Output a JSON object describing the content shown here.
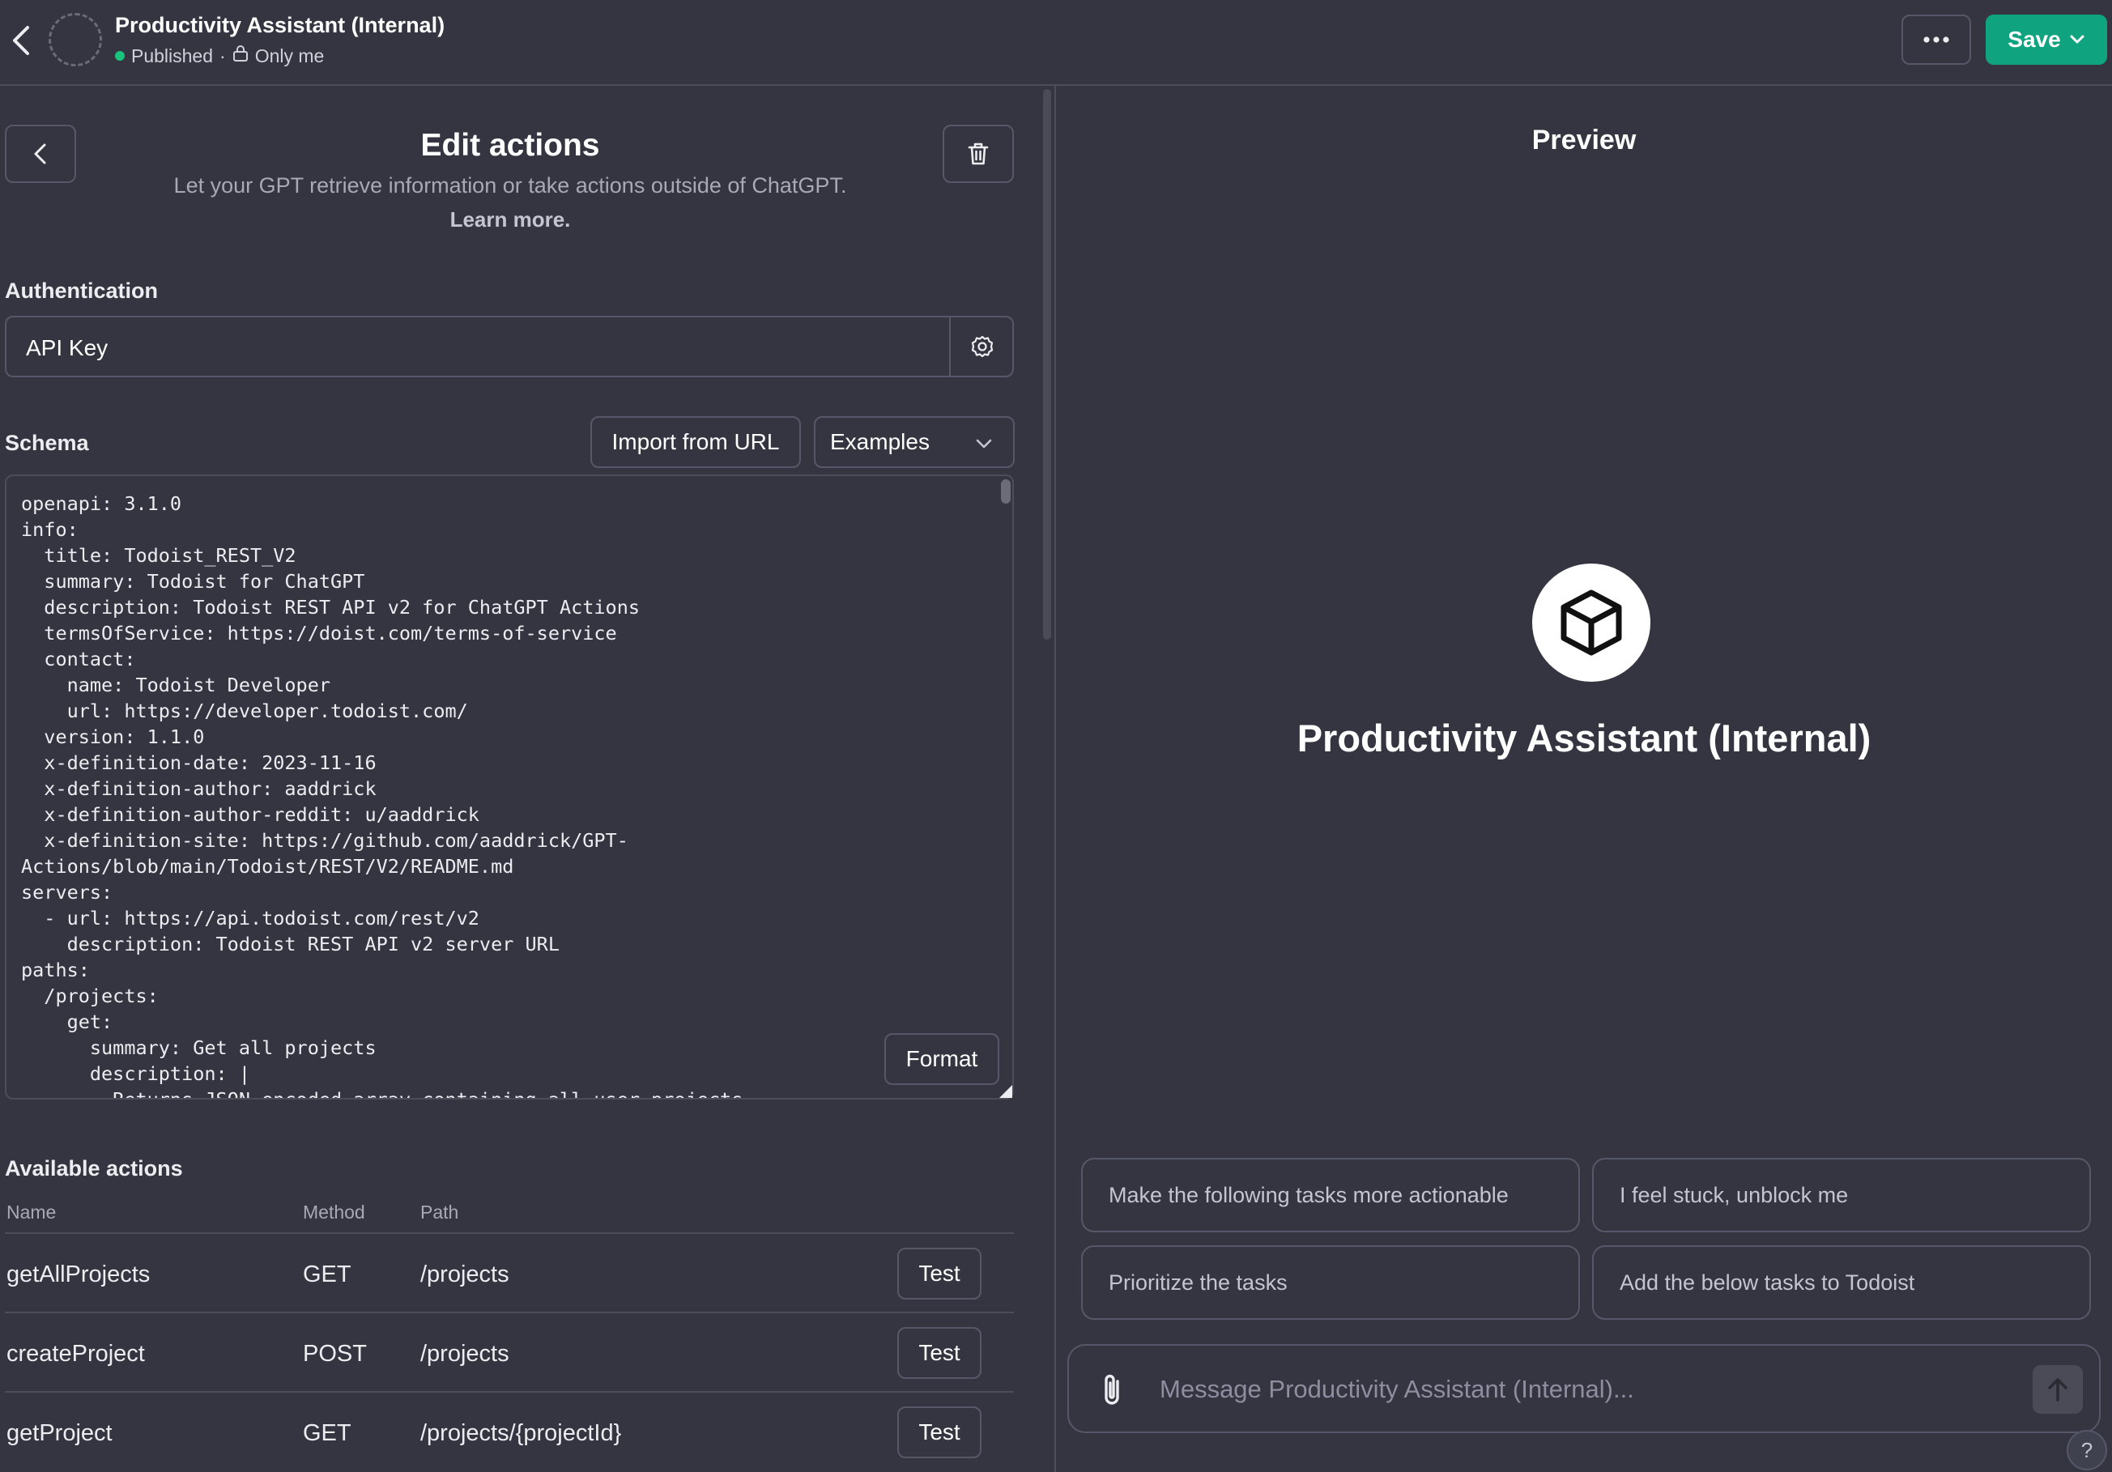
{
  "header": {
    "title": "Productivity Assistant (Internal)",
    "status": "Published",
    "separator": "·",
    "visibility": "Only me",
    "save_label": "Save"
  },
  "editor": {
    "title": "Edit actions",
    "subtitle": "Let your GPT retrieve information or take actions outside of ChatGPT.",
    "learn_more": "Learn more.",
    "authentication_label": "Authentication",
    "authentication_value": "API Key",
    "schema_label": "Schema",
    "import_url_label": "Import from URL",
    "examples_label": "Examples",
    "format_label": "Format",
    "schema_text": "openapi: 3.1.0\ninfo:\n  title: Todoist_REST_V2\n  summary: Todoist for ChatGPT\n  description: Todoist REST API v2 for ChatGPT Actions\n  termsOfService: https://doist.com/terms-of-service\n  contact:\n    name: Todoist Developer\n    url: https://developer.todoist.com/\n  version: 1.1.0\n  x-definition-date: 2023-11-16\n  x-definition-author: aaddrick\n  x-definition-author-reddit: u/aaddrick\n  x-definition-site: https://github.com/aaddrick/GPT-\nActions/blob/main/Todoist/REST/V2/README.md\nservers:\n  - url: https://api.todoist.com/rest/v2\n    description: Todoist REST API v2 server URL\npaths:\n  /projects:\n    get:\n      summary: Get all projects\n      description: |\n        Returns JSON-encoded array containing all user projects"
  },
  "actions": {
    "label": "Available actions",
    "columns": [
      "Name",
      "Method",
      "Path"
    ],
    "test_label": "Test",
    "rows": [
      {
        "name": "getAllProjects",
        "method": "GET",
        "path": "/projects"
      },
      {
        "name": "createProject",
        "method": "POST",
        "path": "/projects"
      },
      {
        "name": "getProject",
        "method": "GET",
        "path": "/projects/{projectId}"
      }
    ]
  },
  "preview": {
    "title": "Preview",
    "gpt_name": "Productivity Assistant (Internal)",
    "starters": [
      "Make the following tasks more actionable",
      "I feel stuck, unblock me",
      "Prioritize the tasks",
      "Add the below tasks to Todoist"
    ],
    "composer_placeholder": "Message Productivity Assistant (Internal)...",
    "help_label": "?"
  },
  "colors": {
    "background": "#343541",
    "accent_green": "#10a37f",
    "border": "#565869"
  }
}
